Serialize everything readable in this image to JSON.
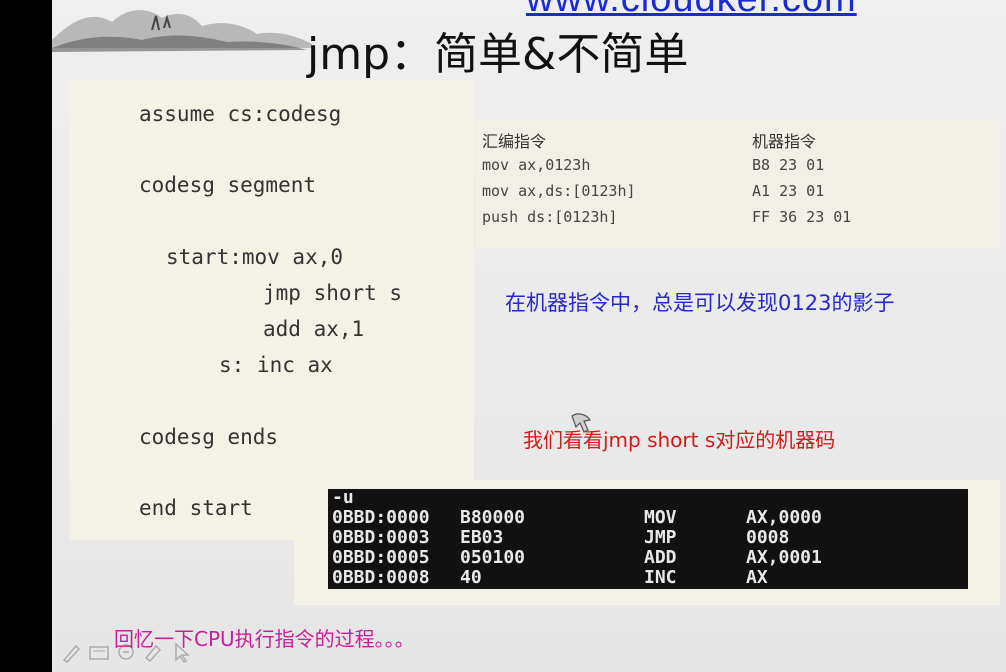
{
  "header": {
    "url_text": "www.cloudker.com",
    "title": "jmp：简单&不简单"
  },
  "code": {
    "lines": [
      "assume cs:codesg",
      "codesg segment",
      "start:mov ax,0",
      "jmp short s",
      "add ax,1",
      "s: inc ax",
      "codesg ends",
      "end start"
    ]
  },
  "instruction_table": {
    "headers": [
      "汇编指令",
      "机器指令"
    ],
    "rows": [
      {
        "asm": "mov ax,0123h",
        "machine": "B8 23 01"
      },
      {
        "asm": "mov ax,ds:[0123h]",
        "machine": "A1 23 01"
      },
      {
        "asm": "push ds:[0123h]",
        "machine": "FF 36 23 01"
      }
    ]
  },
  "notes": {
    "shadow_note": "在机器指令中，总是可以发现0123的影子",
    "look_note": "我们看看jmp short s对应的机器码",
    "recall_note": "回忆一下CPU执行指令的过程。。。"
  },
  "debug": {
    "prompt": "-u",
    "rows": [
      {
        "addr": "0BBD:0000",
        "code": "B80000",
        "op": "MOV",
        "arg": "AX,0000"
      },
      {
        "addr": "0BBD:0003",
        "code": "EB03",
        "op": "JMP",
        "arg": "0008"
      },
      {
        "addr": "0BBD:0005",
        "code": "050100",
        "op": "ADD",
        "arg": "AX,0001"
      },
      {
        "addr": "0BBD:0008",
        "code": "40",
        "op": "INC",
        "arg": "AX"
      }
    ]
  },
  "toolbar": {
    "icons": [
      "pen-icon",
      "slides-icon",
      "zoom-icon",
      "highlighter-icon",
      "pointer-icon"
    ]
  }
}
